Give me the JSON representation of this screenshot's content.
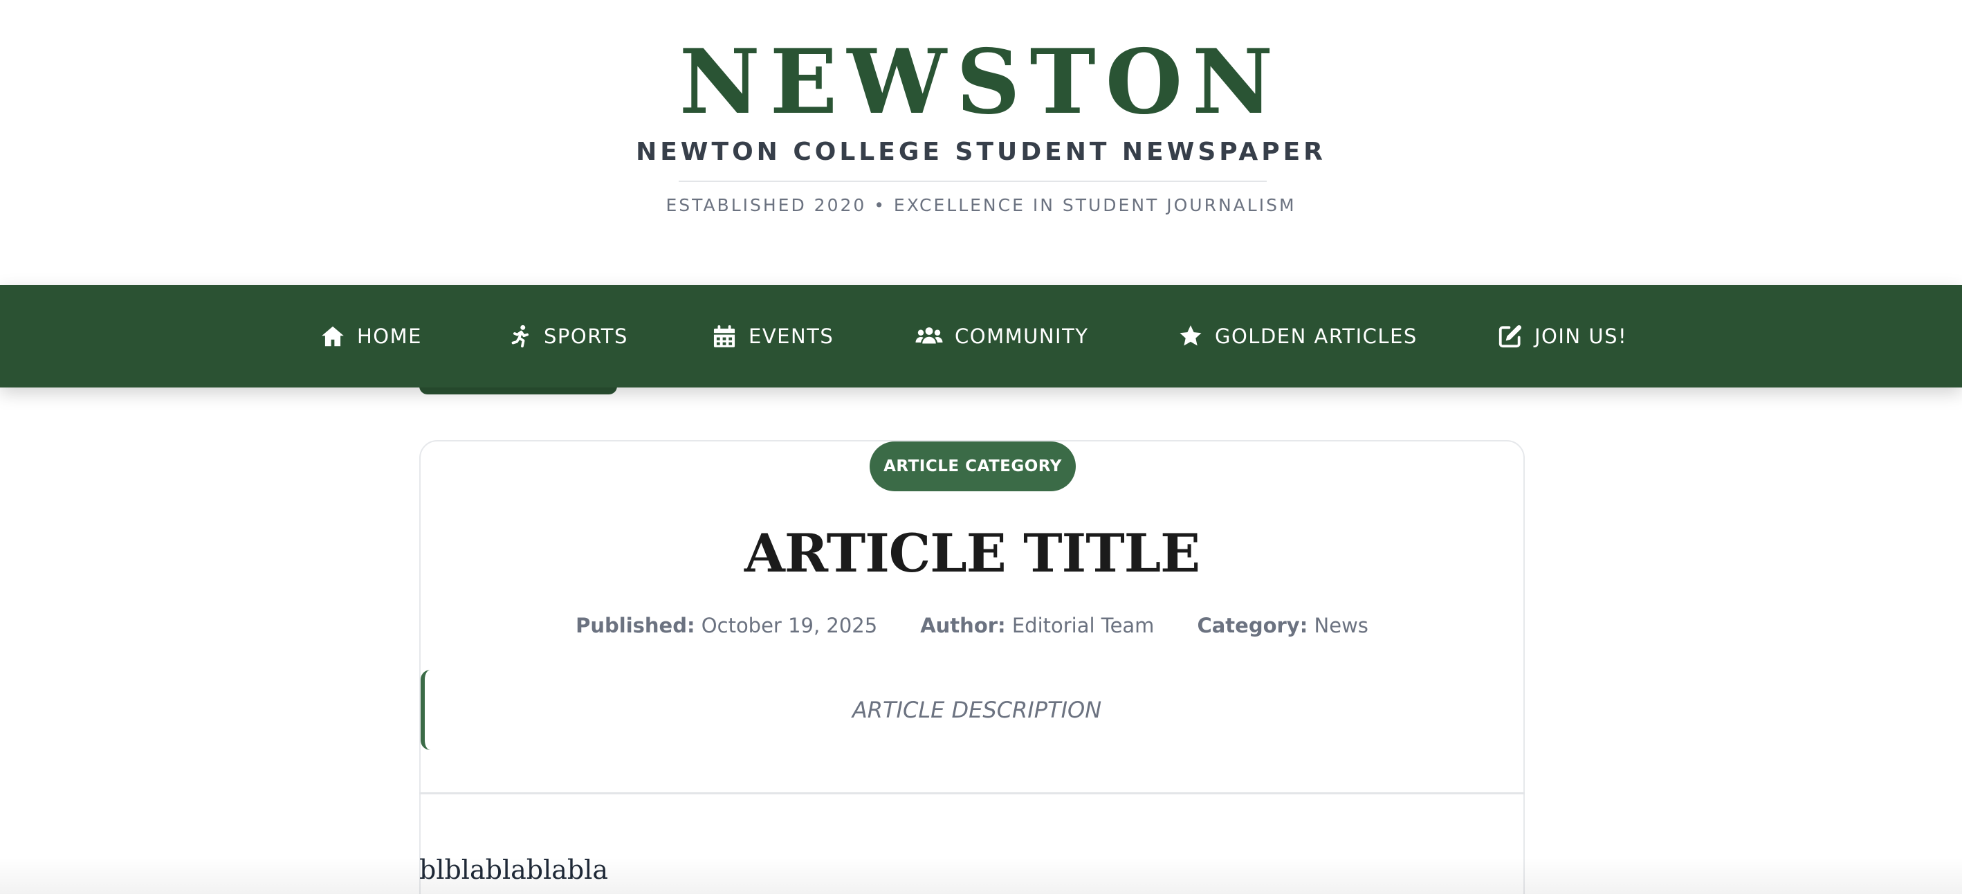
{
  "masthead": {
    "brand": "NEWSTON",
    "subtitle": "NEWTON COLLEGE STUDENT NEWSPAPER",
    "tagline": "ESTABLISHED 2020 • EXCELLENCE IN STUDENT JOURNALISM"
  },
  "colors": {
    "brand_green": "#2a5434",
    "nav_background": "#2b5233",
    "accent_green": "#3b6b47",
    "title_text": "#1b1b1b",
    "muted_text": "#6b7280"
  },
  "nav": {
    "items": [
      {
        "label": "HOME",
        "icon": "home-icon"
      },
      {
        "label": "SPORTS",
        "icon": "running-icon"
      },
      {
        "label": "EVENTS",
        "icon": "calendar-icon"
      },
      {
        "label": "COMMUNITY",
        "icon": "users-icon"
      },
      {
        "label": "GOLDEN ARTICLES",
        "icon": "star-icon"
      },
      {
        "label": "JOIN US!",
        "icon": "edit-icon"
      }
    ]
  },
  "article": {
    "category_badge": "ARTICLE CATEGORY",
    "title": "ARTICLE TITLE",
    "meta": {
      "published_label": "Published:",
      "published_value": "October 19, 2025",
      "author_label": "Author:",
      "author_value": "Editorial Team",
      "category_label": "Category:",
      "category_value": "News"
    },
    "description": "ARTICLE DESCRIPTION",
    "body": "blblablablabla"
  }
}
